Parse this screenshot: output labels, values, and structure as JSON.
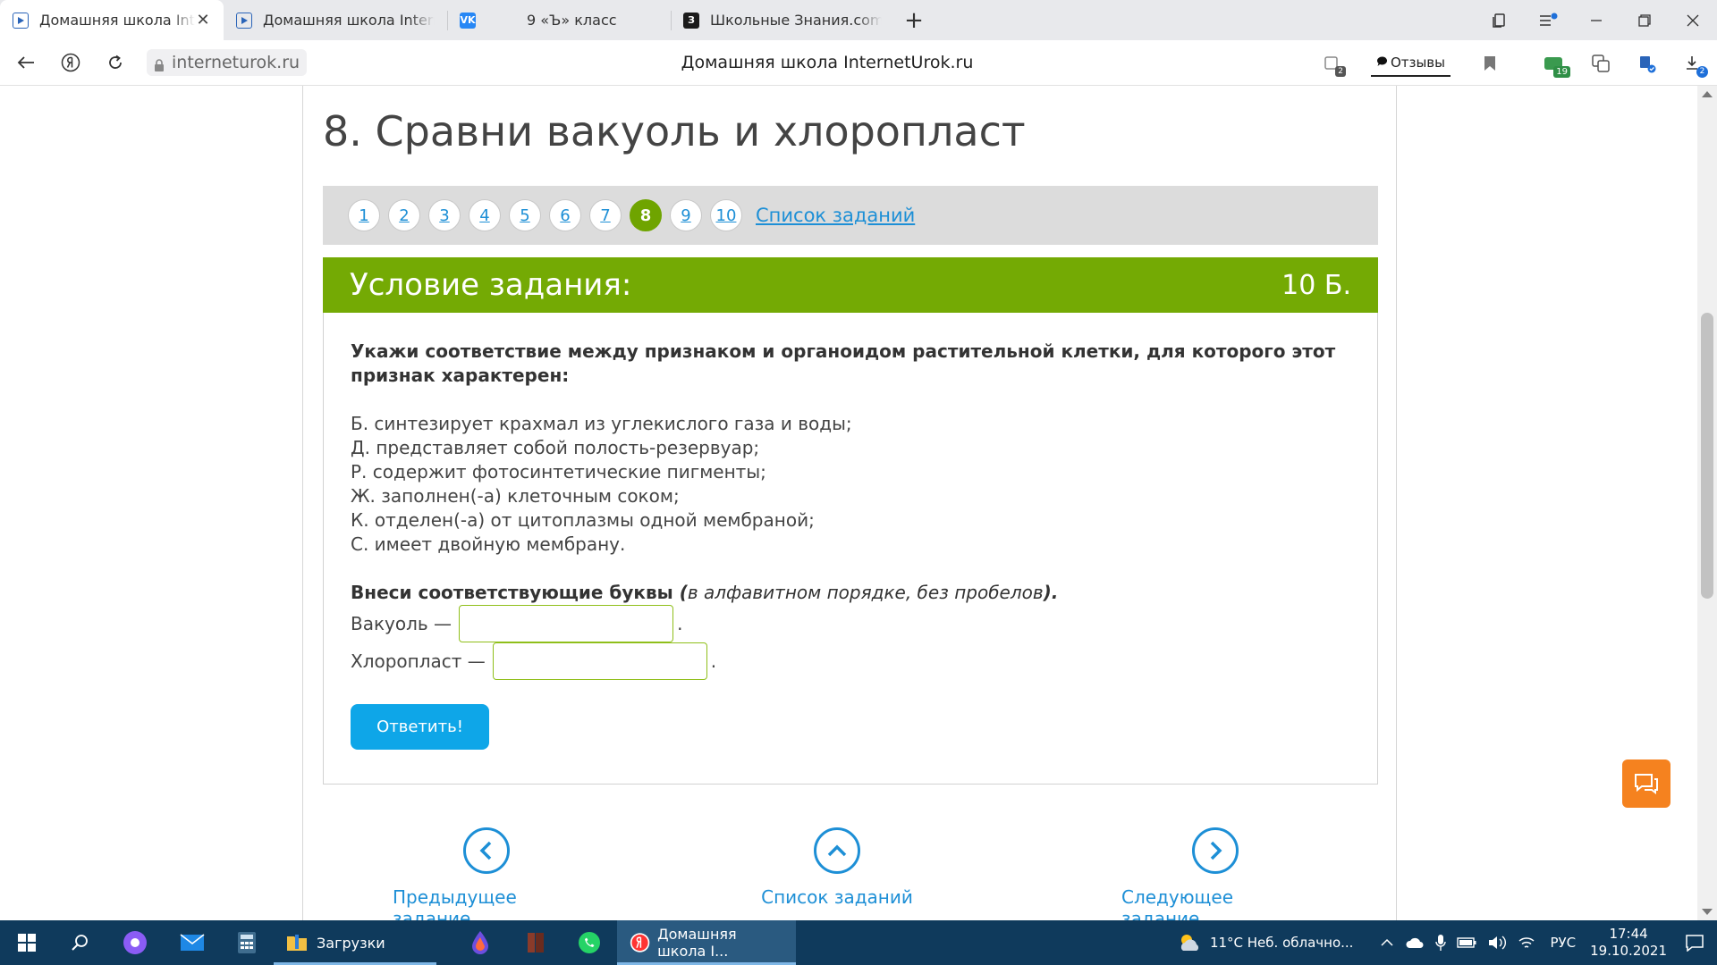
{
  "browser": {
    "tabs": [
      {
        "title": "Домашняя школа Inter",
        "favicon": "play-icon",
        "active": true
      },
      {
        "title": "Домашняя школа Internet",
        "favicon": "play-icon",
        "active": false
      },
      {
        "title": "9 «Ъ» класс",
        "favicon": "vk-icon",
        "active": false
      },
      {
        "title": "Школьные Знания.com - Р",
        "favicon": "znania-icon",
        "active": false
      }
    ],
    "favicon_letters": {
      "vk": "VK",
      "znania": "З"
    },
    "tab_close": "✕",
    "new_tab": "+",
    "url": "interneturok.ru",
    "page_title": "Домашняя школа InternetUrok.ru",
    "reviews_label": "Отзывы",
    "badges": {
      "tabs_count": "2",
      "mail_count": "19",
      "downloads_count": "2"
    }
  },
  "page": {
    "heading": "8. Сравни вакуоль и хлоропласт",
    "pager": {
      "pages": [
        "1",
        "2",
        "3",
        "4",
        "5",
        "6",
        "7",
        "8",
        "9",
        "10"
      ],
      "current": "8",
      "list_link": "Список заданий"
    },
    "task": {
      "header_title": "Условие задания:",
      "score": "10 Б.",
      "instruction": "Укажи соответствие между признаком и органоидом растительной клетки, для которого этот признак характерен:",
      "statements": [
        "Б. синтезирует крахмал из углекислого газа и воды;",
        "Д. представляет собой полость-резервуар;",
        "Р. содержит фотосинтетические пигменты;",
        "Ж. заполнен(-а) клеточным соком;",
        "К. отделен(-а) от цитоплазмы одной мембраной;",
        "С. имеет двойную мембрану."
      ],
      "prompt_main": "Внеси соответствующие буквы ",
      "prompt_paren_open": "(",
      "prompt_paren_text": "в алфавитном порядке, без пробелов",
      "prompt_paren_close": ").",
      "answers": [
        {
          "label": "Вакуоль —",
          "value": ""
        },
        {
          "label": "Хлоропласт —",
          "value": ""
        }
      ],
      "answer_dot": ".",
      "submit_label": "Ответить!"
    },
    "bottom_nav": {
      "prev": "Предыдущее задание",
      "list": "Список заданий",
      "next": "Следующее задание"
    }
  },
  "taskbar": {
    "apps": [
      {
        "label": "Загрузки"
      },
      {
        "label": "Домашняя школа I..."
      }
    ],
    "weather": "11°C  Неб. облачно...",
    "language": "РУС",
    "time": "17:44",
    "date": "19.10.2021"
  },
  "colors": {
    "accent_green": "#74aa04",
    "link_blue": "#1d8fd6",
    "button_blue": "#0ea6e8",
    "chat_orange": "#f5821f",
    "taskbar": "#0f3a5c"
  }
}
